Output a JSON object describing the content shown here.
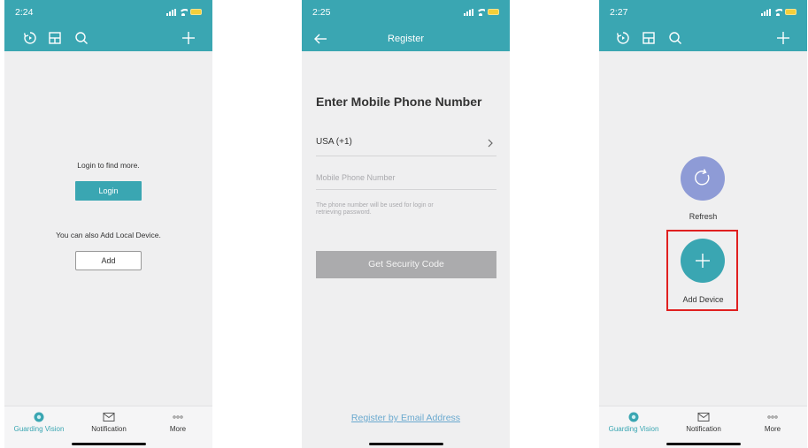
{
  "colors": {
    "accent": "#3aa6b2",
    "highlight": "#e02020",
    "refresh": "#8e9bd6",
    "link": "#6aa9cf"
  },
  "screen1": {
    "status_time": "2:24",
    "toolbar_icons": [
      "history-icon",
      "layout-icon",
      "search-icon",
      "plus-icon"
    ],
    "login_prompt": "Login to find more.",
    "login_button": "Login",
    "local_prompt": "You can also Add Local Device.",
    "add_button": "Add",
    "tabs": [
      {
        "label": "Guarding Vision",
        "active": true
      },
      {
        "label": "Notification",
        "active": false
      },
      {
        "label": "More",
        "active": false
      }
    ]
  },
  "screen2": {
    "status_time": "2:25",
    "nav_title": "Register",
    "heading": "Enter Mobile Phone Number",
    "country": "USA (+1)",
    "phone_placeholder": "Mobile Phone Number",
    "hint_line1": "The phone number will be used for login or",
    "hint_line2": "retrieving password.",
    "code_button": "Get Security Code",
    "email_link": "Register by Email Address"
  },
  "screen3": {
    "status_time": "2:27",
    "refresh_label": "Refresh",
    "add_device_label": "Add Device",
    "tabs": [
      {
        "label": "Guarding Vision",
        "active": true
      },
      {
        "label": "Notification",
        "active": false
      },
      {
        "label": "More",
        "active": false
      }
    ]
  }
}
